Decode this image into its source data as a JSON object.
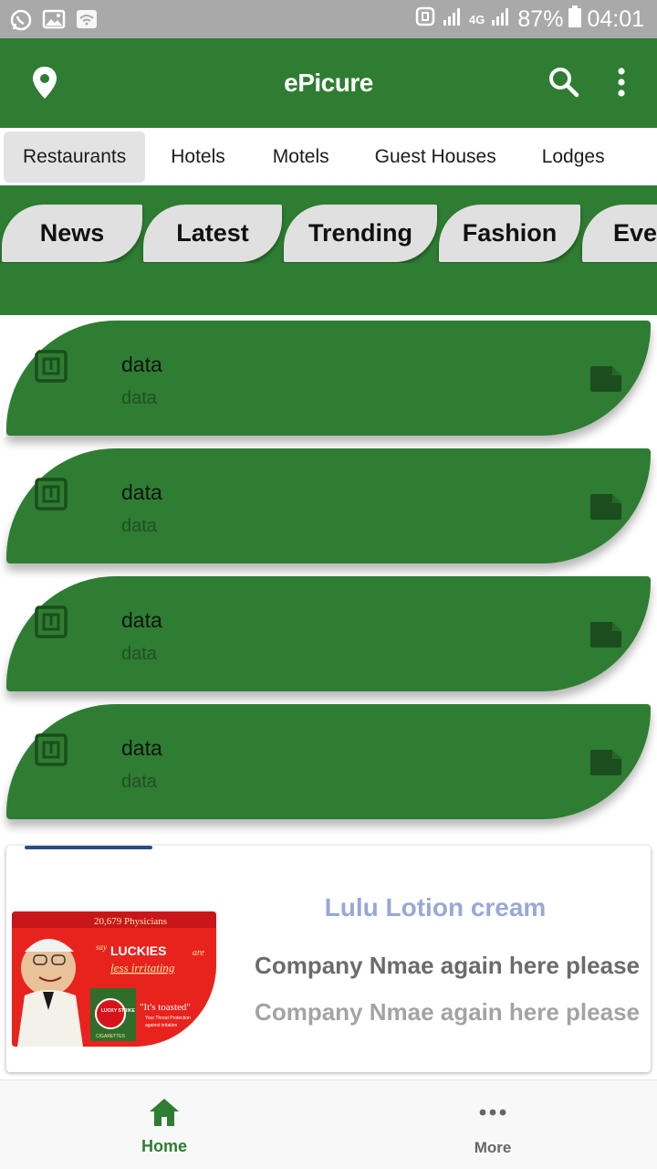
{
  "status_bar": {
    "battery": "87%",
    "time": "04:01",
    "network": "4G",
    "icons": [
      "whatsapp-icon",
      "gallery-icon",
      "wifi-icon",
      "nfc-icon",
      "signal-icon",
      "battery-icon"
    ]
  },
  "app_bar": {
    "title": "ePicure",
    "icons": [
      "location-pin-icon",
      "search-icon",
      "more-vert-icon"
    ],
    "color": "#2e7d32"
  },
  "categories": [
    {
      "label": "Restaurants",
      "selected": true
    },
    {
      "label": "Hotels",
      "selected": false
    },
    {
      "label": "Motels",
      "selected": false
    },
    {
      "label": "Guest Houses",
      "selected": false
    },
    {
      "label": "Lodges",
      "selected": false
    }
  ],
  "chips": [
    "News",
    "Latest",
    "Trending",
    "Fashion",
    "Eve"
  ],
  "list_items": [
    {
      "title": "data",
      "subtitle": "data"
    },
    {
      "title": "data",
      "subtitle": "data"
    },
    {
      "title": "data",
      "subtitle": "data"
    },
    {
      "title": "data",
      "subtitle": "data"
    }
  ],
  "ad": {
    "title": "Lulu Lotion cream",
    "line1": "Company Nmae again here please",
    "line2": "Company Nmae again here please",
    "image_text": {
      "top": "20,679 Physicians",
      "say": "say",
      "brand": "LUCKIES",
      "are": "are",
      "claim": "less irritating",
      "tagline": "\"It's toasted\"",
      "pack": "LUCKY STRIKE",
      "sub": "Your Throat Protection",
      "sub2": "against irritation",
      "cig": "CIGARETTES"
    }
  },
  "bottom_nav": [
    {
      "label": "Home",
      "icon": "home-icon",
      "active": true
    },
    {
      "label": "More",
      "icon": "more-horiz-icon",
      "active": false
    }
  ],
  "colors": {
    "primary": "#2e7d32",
    "chip_bg": "#e0e0e0",
    "ad_title": "#9aa8d6"
  }
}
